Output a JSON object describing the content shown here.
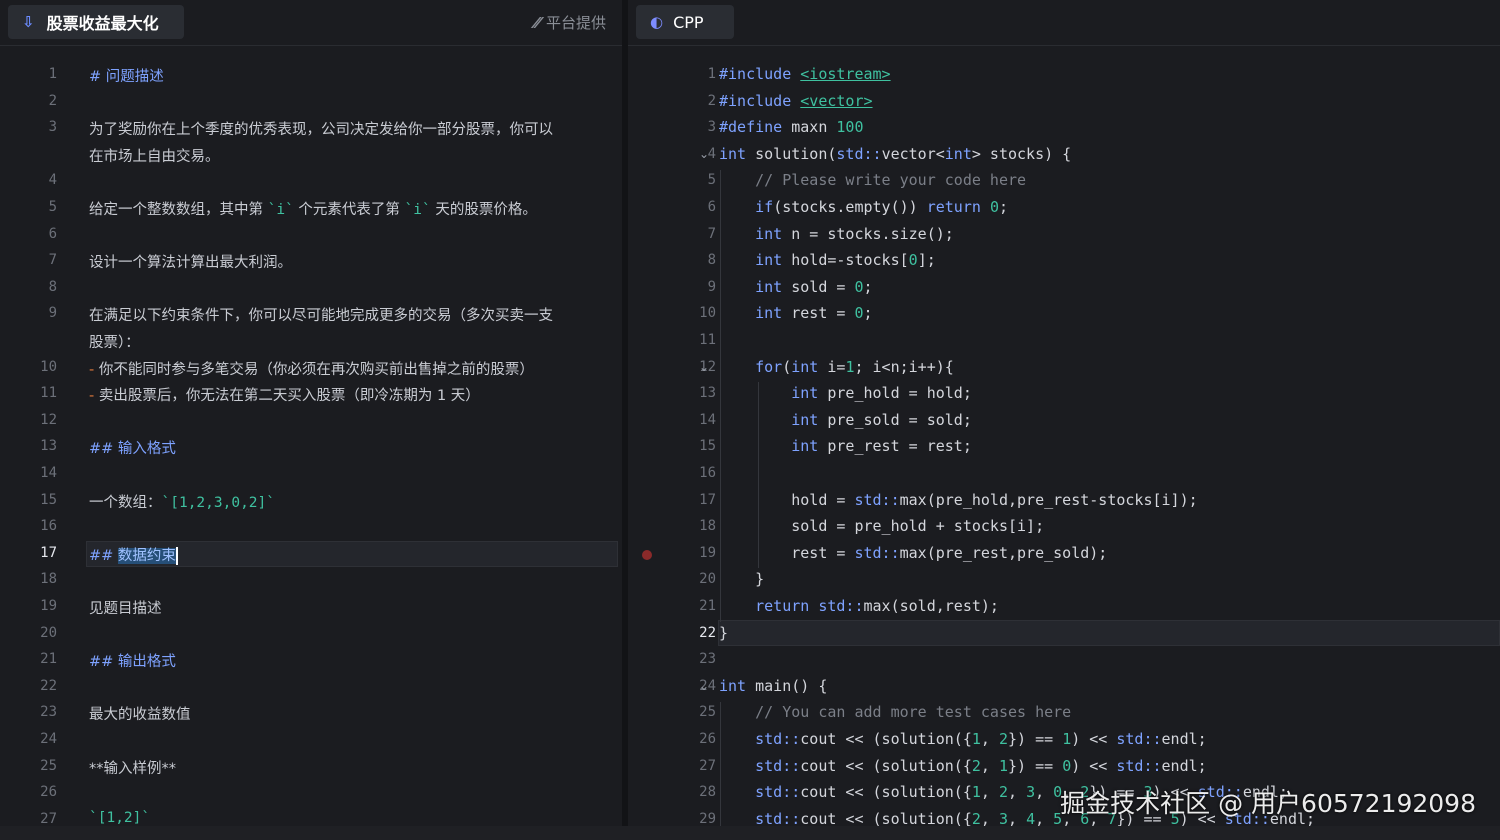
{
  "left_tab": {
    "title": "股票收益最大化",
    "icon": "download-arrow-icon",
    "provider": "平台提供",
    "provider_icon": "platform-logo-icon"
  },
  "right_tab": {
    "title": "CPP",
    "icon": "cpp-language-icon"
  },
  "problem_lines": [
    {
      "n": "1",
      "text": "# 问题描述"
    },
    {
      "n": "2",
      "text": ""
    },
    {
      "n": "3",
      "text": "为了奖励你在上个季度的优秀表现，公司决定发给你一部分股票，你可以"
    },
    {
      "n": "",
      "text": "在市场上自由交易。"
    },
    {
      "n": "4",
      "text": ""
    },
    {
      "n": "5",
      "text_a": "给定一个整数数组，其中第 ",
      "code_a": "`i`",
      "text_b": " 个元素代表了第 ",
      "code_b": "`i`",
      "text_c": " 天的股票价格。"
    },
    {
      "n": "6",
      "text": ""
    },
    {
      "n": "7",
      "text": "设计一个算法计算出最大利润。"
    },
    {
      "n": "8",
      "text": ""
    },
    {
      "n": "9",
      "text": "在满足以下约束条件下，你可以尽可能地完成更多的交易（多次买卖一支"
    },
    {
      "n": "",
      "text": "股票）："
    },
    {
      "n": "10",
      "dash": "-",
      "text": " 你不能同时参与多笔交易（你必须在再次购买前出售掉之前的股票）"
    },
    {
      "n": "11",
      "dash": "-",
      "text": " 卖出股票后，你无法在第二天买入股票（即冷冻期为 1 天）"
    },
    {
      "n": "12",
      "text": ""
    },
    {
      "n": "13",
      "text": "## 输入格式"
    },
    {
      "n": "14",
      "text": ""
    },
    {
      "n": "15",
      "text_a": "一个数组：",
      "code_a": "`[1,2,3,0,2]`"
    },
    {
      "n": "16",
      "text": ""
    },
    {
      "n": "17",
      "hash": "##",
      "sel": "数据约束"
    },
    {
      "n": "18",
      "text": ""
    },
    {
      "n": "19",
      "text": "见题目描述"
    },
    {
      "n": "20",
      "text": ""
    },
    {
      "n": "21",
      "text": "## 输出格式"
    },
    {
      "n": "22",
      "text": ""
    },
    {
      "n": "23",
      "text": "最大的收益数值"
    },
    {
      "n": "24",
      "text": ""
    },
    {
      "n": "25",
      "text": "**输入样例**"
    },
    {
      "n": "26",
      "text": ""
    },
    {
      "n": "27",
      "code_a": "`[1,2]`"
    }
  ],
  "code_lines": [
    "1",
    "2",
    "3",
    "4",
    "5",
    "6",
    "7",
    "8",
    "9",
    "10",
    "11",
    "12",
    "13",
    "14",
    "15",
    "16",
    "17",
    "18",
    "19",
    "20",
    "21",
    "22",
    "23",
    "24",
    "25",
    "26",
    "27",
    "28",
    "29"
  ],
  "code": {
    "l1a": "#include ",
    "l1b": "<iostream>",
    "l2a": "#include ",
    "l2b": "<vector>",
    "l3a": "#define ",
    "l3b": "maxn ",
    "l3c": "100",
    "l4a": "int ",
    "l4b": "solution(",
    "l4c": "std::",
    "l4d": "vector<",
    "l4e": "int",
    "l4f": "> stocks) {",
    "l5": "// Please write your code here",
    "l6a": "if",
    "l6b": "(stocks.empty()) ",
    "l6c": "return ",
    "l6d": "0",
    "l6e": ";",
    "l7a": "int ",
    "l7b": "n = stocks.size();",
    "l8a": "int ",
    "l8b": "hold=-stocks[",
    "l8c": "0",
    "l8d": "];",
    "l9a": "int ",
    "l9b": "sold = ",
    "l9c": "0",
    "l9d": ";",
    "l10a": "int ",
    "l10b": "rest = ",
    "l10c": "0",
    "l10d": ";",
    "l12a": "for",
    "l12b": "(",
    "l12c": "int ",
    "l12d": "i=",
    "l12e": "1",
    "l12f": "; i<n;i++){",
    "l13a": "int ",
    "l13b": "pre_hold = hold;",
    "l14a": "int ",
    "l14b": "pre_sold = sold;",
    "l15a": "int ",
    "l15b": "pre_rest = rest;",
    "l17a": "hold = ",
    "l17b": "std::",
    "l17c": "max(pre_hold,pre_rest-stocks[i]);",
    "l18": "sold = pre_hold + stocks[i];",
    "l19a": "rest = ",
    "l19b": "std::",
    "l19c": "max(pre_rest,pre_sold);",
    "l20": "}",
    "l21a": "return ",
    "l21b": "std::",
    "l21c": "max(sold,rest);",
    "l22": "}",
    "l24a": "int ",
    "l24b": "main() {",
    "l25": "// You can add more test cases here",
    "l26a": "std::",
    "l26b": "cout << (solution({",
    "l26c": "1",
    "l26d": ", ",
    "l26e": "2",
    "l26f": "}) == ",
    "l26g": "1",
    "l26h": ") << ",
    "l26i": "std::",
    "l26j": "endl;",
    "l27a": "std::",
    "l27b": "cout << (solution({",
    "l27c": "2",
    "l27d": ", ",
    "l27e": "1",
    "l27f": "}) == ",
    "l27g": "0",
    "l27h": ") << ",
    "l27i": "std::",
    "l27j": "endl;",
    "l28a": "std::",
    "l28b": "cout << (solution({",
    "l28c": "1",
    "l28d": ", ",
    "l28e": "2",
    "l28f": ", ",
    "l28g": "3",
    "l28h": ", ",
    "l28i": "0",
    "l28j": ", ",
    "l28k": "2",
    "l28l": "}) == ",
    "l28m": "3",
    "l28n": ") << ",
    "l28o": "std::",
    "l28p": "endl;",
    "l29a": "std::",
    "l29b": "cout << (solution({",
    "l29c": "2",
    "l29d": ", ",
    "l29e": "3",
    "l29f": ", ",
    "l29g": "4",
    "l29h": ", ",
    "l29i": "5",
    "l29j": ", ",
    "l29k": "6",
    "l29l": ", ",
    "l29m": "7",
    "l29n": "}) == ",
    "l29o": "5",
    "l29p": ") << ",
    "l29q": "std::",
    "l29r": "endl;"
  },
  "watermark": "掘金技术社区 @ 用户60572192098",
  "colors": {
    "keyword": "#7ea2ff",
    "string": "#3fc1a0",
    "comment": "#7b7f88",
    "list_dash": "#e0793b",
    "selection": "#264f78"
  }
}
